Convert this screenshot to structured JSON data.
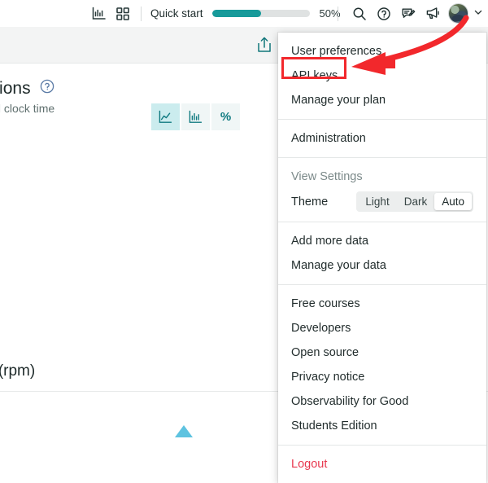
{
  "topbar": {
    "icons": [
      {
        "name": "bar-chart-icon",
        "label": "bar-chart-icon"
      },
      {
        "name": "apps-grid-icon",
        "label": "apps-grid-icon"
      }
    ],
    "quick_start_label": "Quick start",
    "progress_percent_label": "50%",
    "progress_percent_value": 50,
    "right_icons": [
      {
        "name": "search-icon",
        "label": "search-icon"
      },
      {
        "name": "help-icon",
        "label": "help-icon"
      },
      {
        "name": "feedback-icon",
        "label": "feedback-icon"
      },
      {
        "name": "announcement-icon",
        "label": "announcement-icon"
      }
    ],
    "avatar_label": "user-avatar",
    "chevron_label": "⌄"
  },
  "page": {
    "share_icon_label": "share-icon",
    "title": "web transactions",
    "title_help_label": "?",
    "subtitle": "ent of wall clock time",
    "chart_toggle": [
      {
        "name": "area-chart-view",
        "glyph": "area",
        "active": true
      },
      {
        "name": "bar-chart-view",
        "glyph": "bars",
        "active": false
      },
      {
        "name": "percent-view",
        "glyph": "%",
        "active": false
      }
    ],
    "section_title": "ghput (rpm)"
  },
  "menu": {
    "sections": [
      {
        "items": [
          {
            "label": "User preferences",
            "style": "normal",
            "name": "menu-item-user-preferences"
          },
          {
            "label": "API keys",
            "style": "normal",
            "name": "menu-item-api-keys",
            "highlighted": true
          },
          {
            "label": "Manage your plan",
            "style": "normal",
            "name": "menu-item-manage-your-plan"
          }
        ]
      },
      {
        "items": [
          {
            "label": "Administration",
            "style": "normal",
            "name": "menu-item-administration"
          }
        ]
      },
      {
        "heading": "View Settings",
        "theme_label": "Theme",
        "theme_options": [
          "Light",
          "Dark",
          "Auto"
        ],
        "theme_selected": "Auto"
      },
      {
        "items": [
          {
            "label": "Add more data",
            "style": "normal",
            "name": "menu-item-add-more-data"
          },
          {
            "label": "Manage your data",
            "style": "normal",
            "name": "menu-item-manage-your-data"
          }
        ]
      },
      {
        "items": [
          {
            "label": "Free courses",
            "style": "normal",
            "name": "menu-item-free-courses"
          },
          {
            "label": "Developers",
            "style": "normal",
            "name": "menu-item-developers"
          },
          {
            "label": "Open source",
            "style": "normal",
            "name": "menu-item-open-source"
          },
          {
            "label": "Privacy notice",
            "style": "normal",
            "name": "menu-item-privacy-notice"
          },
          {
            "label": "Observability for Good",
            "style": "normal",
            "name": "menu-item-observability-for-good"
          },
          {
            "label": "Students Edition",
            "style": "normal",
            "name": "menu-item-students-edition"
          }
        ]
      },
      {
        "items": [
          {
            "label": "Logout",
            "style": "logout",
            "name": "menu-item-logout"
          }
        ]
      }
    ]
  },
  "annotation": {
    "arrow_label": "red-arrow-pointing-to-api-keys",
    "highlight_label": "red-highlight-box-api-keys",
    "color": "#f2282c"
  },
  "colors": {
    "accent_teal": "#179a9a",
    "logout_red": "#e8384f",
    "annotation_red": "#f2282c",
    "toolbar_band": "#f3f4f4"
  }
}
